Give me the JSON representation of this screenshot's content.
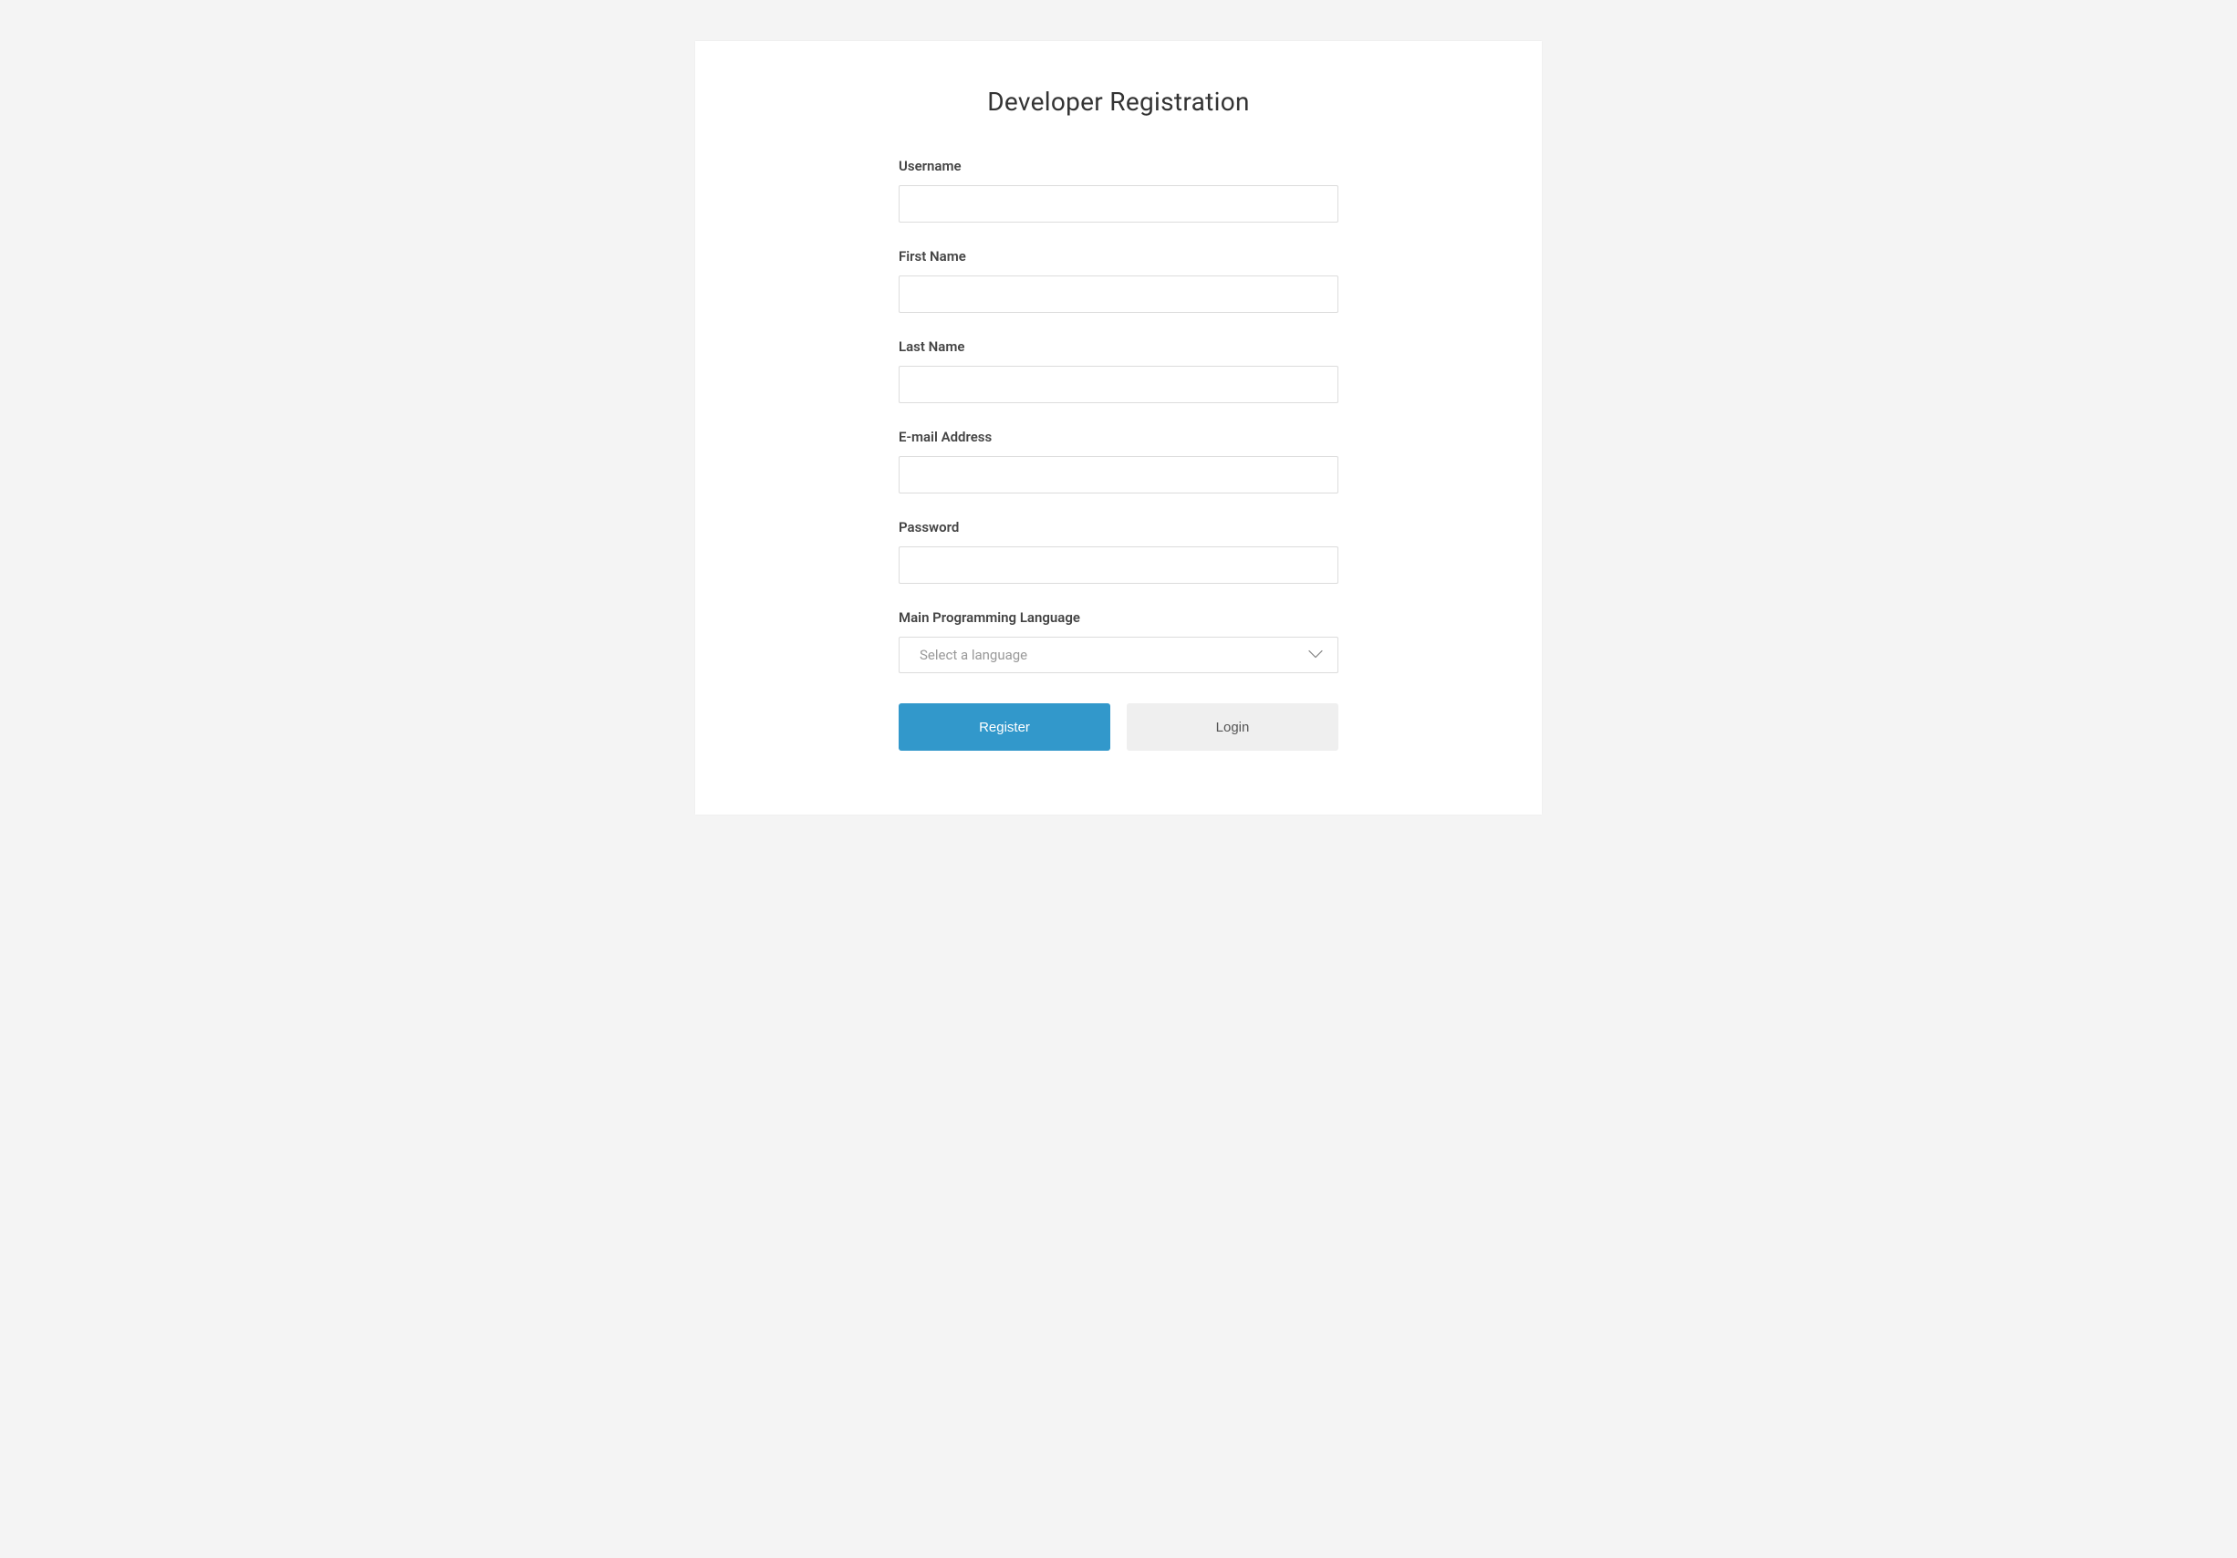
{
  "title": "Developer Registration",
  "fields": {
    "username": {
      "label": "Username",
      "value": ""
    },
    "first_name": {
      "label": "First Name",
      "value": ""
    },
    "last_name": {
      "label": "Last Name",
      "value": ""
    },
    "email": {
      "label": "E-mail Address",
      "value": ""
    },
    "password": {
      "label": "Password",
      "value": ""
    },
    "language": {
      "label": "Main Programming Language",
      "placeholder": "Select a language"
    }
  },
  "buttons": {
    "register": "Register",
    "login": "Login"
  }
}
